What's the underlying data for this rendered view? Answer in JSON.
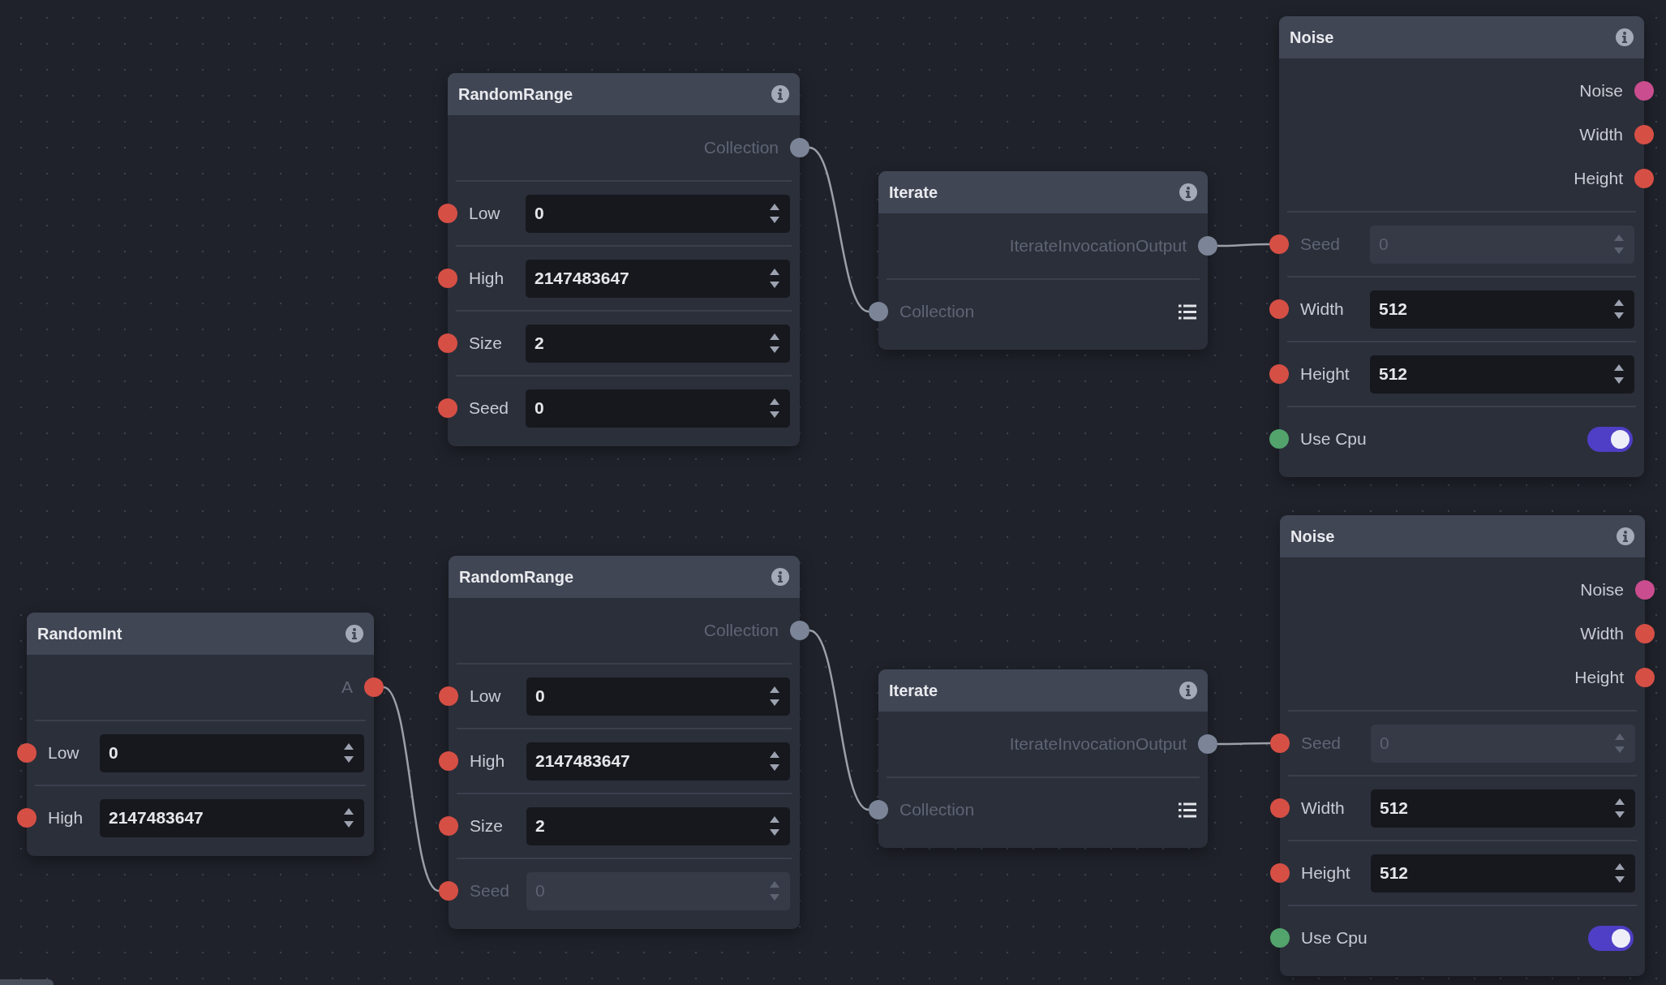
{
  "nodes": [
    {
      "title": "RandomRange",
      "outputs": [
        {
          "label": "Collection",
          "color": "#7b8597",
          "connected": true
        }
      ],
      "inputs": [
        {
          "kind": "number",
          "label": "Low",
          "value": "0",
          "color": "#d64f45",
          "connected": false
        },
        {
          "kind": "number",
          "label": "High",
          "value": "2147483647",
          "color": "#d64f45",
          "connected": false
        },
        {
          "kind": "number",
          "label": "Size",
          "value": "2",
          "color": "#d64f45",
          "connected": false
        },
        {
          "kind": "number",
          "label": "Seed",
          "value": "0",
          "color": "#d64f45",
          "connected": false
        }
      ]
    },
    {
      "title": "Iterate",
      "outputs": [
        {
          "label": "IterateInvocationOutput",
          "color": "#7b8597",
          "connected": true
        }
      ],
      "inputs": [
        {
          "kind": "list",
          "label": "Collection",
          "color": "#7b8597",
          "connected": true
        }
      ]
    },
    {
      "title": "Noise",
      "outputs": [
        {
          "label": "Noise",
          "color": "#c94d8f",
          "connected": false
        },
        {
          "label": "Width",
          "color": "#d64f45",
          "connected": false
        },
        {
          "label": "Height",
          "color": "#d64f45",
          "connected": false
        }
      ],
      "inputs": [
        {
          "kind": "number",
          "label": "Seed",
          "value": "0",
          "color": "#d64f45",
          "connected": true
        },
        {
          "kind": "number",
          "label": "Width",
          "value": "512",
          "color": "#d64f45",
          "connected": false
        },
        {
          "kind": "number",
          "label": "Height",
          "value": "512",
          "color": "#d64f45",
          "connected": false
        },
        {
          "kind": "toggle",
          "label": "Use Cpu",
          "on": true,
          "color": "#52a36c",
          "connected": false
        }
      ]
    },
    {
      "title": "RandomInt",
      "outputs": [
        {
          "label": "A",
          "color": "#d64f45",
          "connected": true
        }
      ],
      "inputs": [
        {
          "kind": "number",
          "label": "Low",
          "value": "0",
          "color": "#d64f45",
          "connected": false
        },
        {
          "kind": "number",
          "label": "High",
          "value": "2147483647",
          "color": "#d64f45",
          "connected": false
        }
      ]
    },
    {
      "title": "RandomRange",
      "outputs": [
        {
          "label": "Collection",
          "color": "#7b8597",
          "connected": true
        }
      ],
      "inputs": [
        {
          "kind": "number",
          "label": "Low",
          "value": "0",
          "color": "#d64f45",
          "connected": false
        },
        {
          "kind": "number",
          "label": "High",
          "value": "2147483647",
          "color": "#d64f45",
          "connected": false
        },
        {
          "kind": "number",
          "label": "Size",
          "value": "2",
          "color": "#d64f45",
          "connected": false
        },
        {
          "kind": "number",
          "label": "Seed",
          "value": "0",
          "color": "#d64f45",
          "connected": true
        }
      ]
    },
    {
      "title": "Iterate",
      "outputs": [
        {
          "label": "IterateInvocationOutput",
          "color": "#7b8597",
          "connected": true
        }
      ],
      "inputs": [
        {
          "kind": "list",
          "label": "Collection",
          "color": "#7b8597",
          "connected": true
        }
      ]
    },
    {
      "title": "Noise",
      "outputs": [
        {
          "label": "Noise",
          "color": "#c94d8f",
          "connected": false
        },
        {
          "label": "Width",
          "color": "#d64f45",
          "connected": false
        },
        {
          "label": "Height",
          "color": "#d64f45",
          "connected": false
        }
      ],
      "inputs": [
        {
          "kind": "number",
          "label": "Seed",
          "value": "0",
          "color": "#d64f45",
          "connected": true
        },
        {
          "kind": "number",
          "label": "Width",
          "value": "512",
          "color": "#d64f45",
          "connected": false
        },
        {
          "kind": "number",
          "label": "Height",
          "value": "512",
          "color": "#d64f45",
          "connected": false
        },
        {
          "kind": "toggle",
          "label": "Use Cpu",
          "on": true,
          "color": "#52a36c",
          "connected": false
        }
      ]
    }
  ]
}
